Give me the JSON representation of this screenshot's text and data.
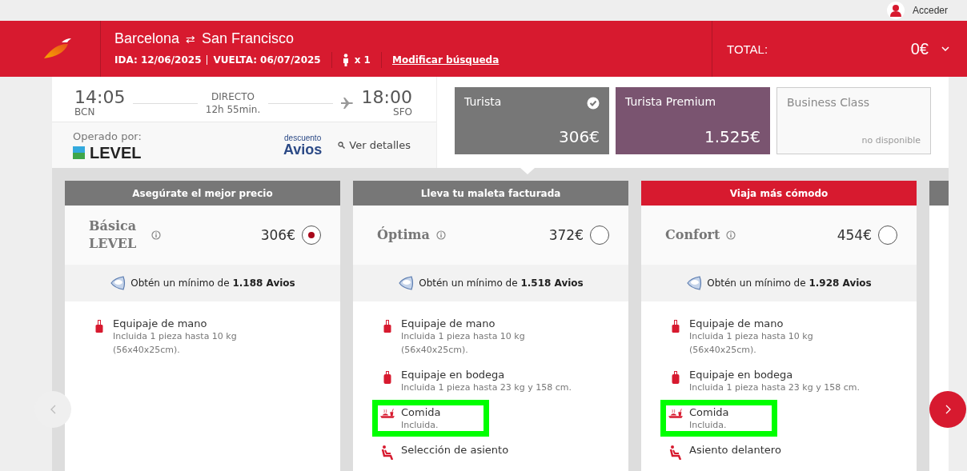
{
  "top_bar": {
    "login": "Acceder"
  },
  "header": {
    "origin": "Barcelona",
    "swap": "⇄",
    "destination": "San Francisco",
    "outbound": "IDA: 12/06/2025",
    "return": "VUELTA: 06/07/2025",
    "passengers": "x 1",
    "modify_link": "Modificar búsqueda",
    "total_label": "TOTAL:",
    "total_value": "0€"
  },
  "flight": {
    "departure_time": "14:05",
    "departure_airport": "BCN",
    "stops": "DIRECTO",
    "duration": "12h 55min.",
    "arrival_time": "18:00",
    "arrival_airport": "SFO",
    "operated_by": "Operado por:",
    "airline": "LEVEL",
    "discount_top": "descuento",
    "discount_brand": "Avios",
    "details_link": "Ver detalles"
  },
  "cabins": [
    {
      "name": "Turista",
      "price": "306€",
      "selected": true,
      "available": true,
      "color": "#777777"
    },
    {
      "name": "Turista Premium",
      "price": "1.525€",
      "selected": false,
      "available": true,
      "color": "#7a5470"
    },
    {
      "name": "Business Class",
      "price": "no disponible",
      "selected": false,
      "available": false,
      "color": "#f9f9f9"
    }
  ],
  "fares": [
    {
      "banner": "Asegúrate el mejor precio",
      "highlighted": false,
      "name": "Básica LEVEL",
      "price": "306€",
      "selected": true,
      "avios": "Obtén un mínimo de **1.188 Avios**",
      "features": [
        {
          "kind": "cabin-bag",
          "title": "Equipaje de mano",
          "detail": "Incluida 1 pieza hasta 10 kg (56x40x25cm).",
          "marked": false
        }
      ]
    },
    {
      "banner": "Lleva tu maleta facturada",
      "highlighted": false,
      "name": "Óptima",
      "price": "372€",
      "selected": false,
      "avios": "Obtén un mínimo de **1.518 Avios**",
      "features": [
        {
          "kind": "cabin-bag",
          "title": "Equipaje de mano",
          "detail": "Incluida 1 pieza hasta 10 kg (56x40x25cm).",
          "marked": false
        },
        {
          "kind": "hold-bag",
          "title": "Equipaje en bodega",
          "detail": "Incluida 1 pieza hasta 23 kg y 158 cm.",
          "marked": false
        },
        {
          "kind": "meal",
          "title": "Comida",
          "detail": "Incluida.",
          "marked": true
        },
        {
          "kind": "seat",
          "title": "Selección de asiento",
          "marked": false
        }
      ]
    },
    {
      "banner": "Viaja más cómodo",
      "highlighted": true,
      "name": "Confort",
      "price": "454€",
      "selected": false,
      "avios": "Obtén un mínimo de **1.928 Avios**",
      "features": [
        {
          "kind": "cabin-bag",
          "title": "Equipaje de mano",
          "detail": "Incluida 1 pieza hasta 10 kg (56x40x25cm).",
          "marked": false
        },
        {
          "kind": "hold-bag",
          "title": "Equipaje en bodega",
          "detail": "Incluida 1 pieza hasta 23 kg y 158 cm.",
          "marked": false
        },
        {
          "kind": "meal",
          "title": "Comida",
          "detail": "Incluida.",
          "marked": true
        },
        {
          "kind": "seat",
          "title": "Asiento delantero",
          "marked": false
        }
      ]
    }
  ]
}
